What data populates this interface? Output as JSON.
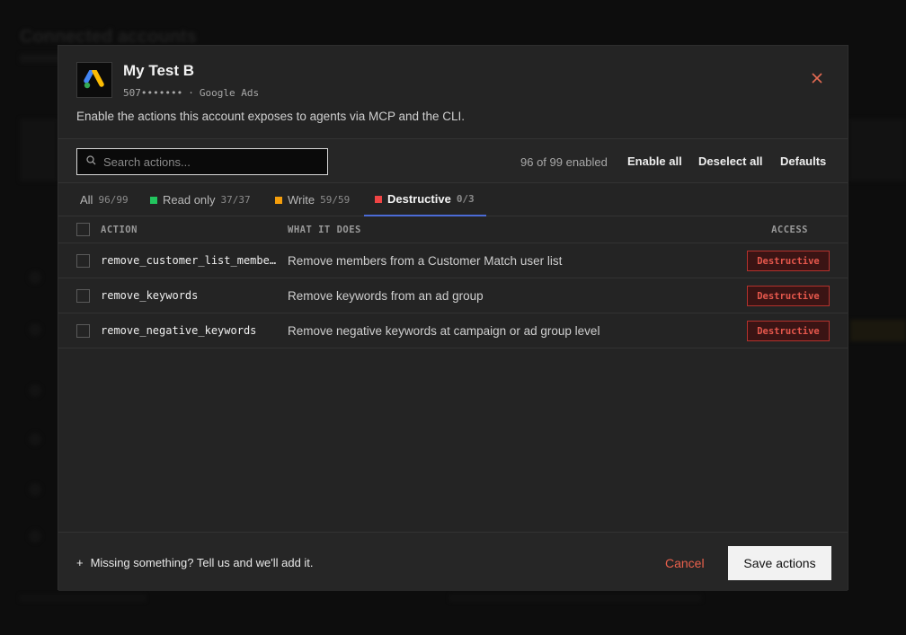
{
  "background": {
    "page_title": "Connected accounts"
  },
  "account": {
    "name": "My Test B",
    "id_masked": "507•••••••",
    "separator": "·",
    "platform": "Google Ads",
    "logo_icon": "google-ads-icon"
  },
  "description": "Enable the actions this account exposes to agents via MCP and the CLI.",
  "toolbar": {
    "search_placeholder": "Search actions...",
    "enabled_count": "96 of 99 enabled",
    "enable_all": "Enable all",
    "deselect_all": "Deselect all",
    "defaults": "Defaults"
  },
  "tabs": [
    {
      "label": "All",
      "count": "96/99",
      "color": ""
    },
    {
      "label": "Read only",
      "count": "37/37",
      "color": "#22c55e"
    },
    {
      "label": "Write",
      "count": "59/59",
      "color": "#f59e0b"
    },
    {
      "label": "Destructive",
      "count": "0/3",
      "color": "#ef4444",
      "active": true
    }
  ],
  "table": {
    "headers": {
      "action": "ACTION",
      "what": "WHAT IT DOES",
      "access": "ACCESS"
    },
    "rows": [
      {
        "action": "remove_customer_list_membe…",
        "what": "Remove members from a Customer Match user list",
        "access": "Destructive"
      },
      {
        "action": "remove_keywords",
        "what": "Remove keywords from an ad group",
        "access": "Destructive"
      },
      {
        "action": "remove_negative_keywords",
        "what": "Remove negative keywords at campaign or ad group level",
        "access": "Destructive"
      }
    ]
  },
  "footer": {
    "plus": "+",
    "missing": "Missing something? Tell us and we'll add it.",
    "cancel": "Cancel",
    "save": "Save actions"
  },
  "colors": {
    "accent_tab": "#4b6bd6",
    "destructive": "#e5574c",
    "cancel": "#e9604c"
  }
}
